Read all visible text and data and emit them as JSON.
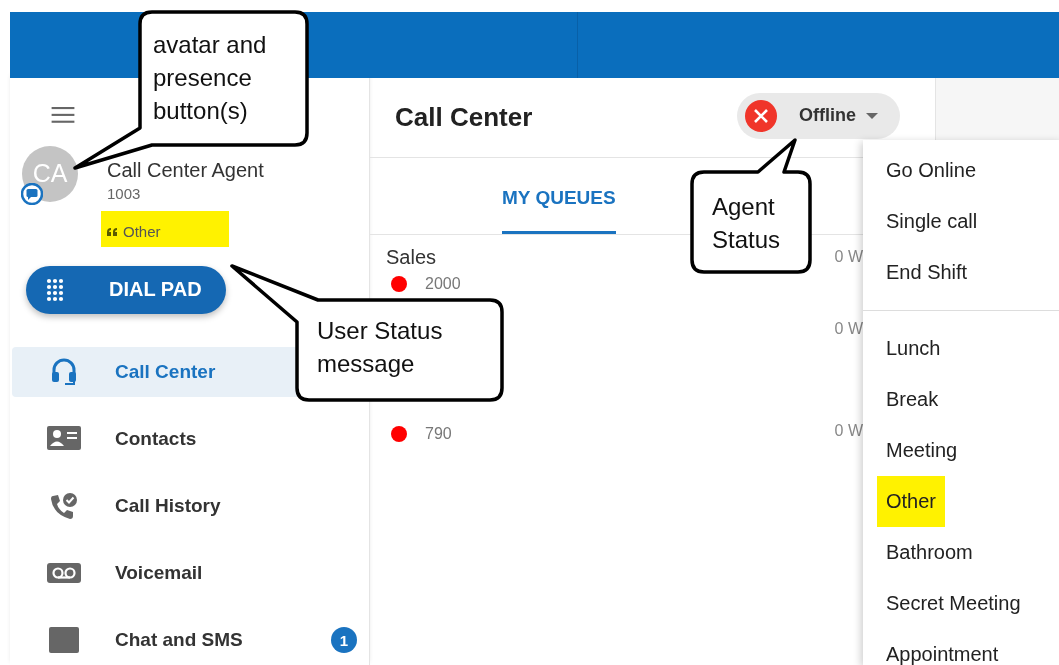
{
  "sidebar": {
    "user": {
      "initials": "CA",
      "name": "Call Center Agent",
      "extension": "1003",
      "status_message": {
        "text": "Other",
        "highlighted": true
      }
    },
    "dial_pad_button": "DIAL PAD",
    "nav_items": [
      {
        "kind": "headset",
        "label": "Call Center",
        "selected": true
      },
      {
        "kind": "contacts",
        "label": "Contacts",
        "selected": false
      },
      {
        "kind": "history",
        "label": "Call History",
        "selected": false
      },
      {
        "kind": "voicemail",
        "label": "Voicemail",
        "selected": false
      },
      {
        "kind": "chat",
        "label": "Chat and SMS",
        "selected": false,
        "badge": "1"
      }
    ]
  },
  "main": {
    "title": "Call Center",
    "agent_status": {
      "label": "Offline"
    },
    "tabs": [
      {
        "label": "MY QUEUES",
        "selected": true
      }
    ],
    "queues": [
      {
        "name": "Sales",
        "number": "2000",
        "color": "#ff0000",
        "wait": "0 W"
      },
      {
        "wait": "0 W"
      },
      {
        "number": "790",
        "color": "#ff0000",
        "wait": "0 W"
      }
    ]
  },
  "status_menu": {
    "groups": [
      {
        "items": [
          {
            "label": "Go Online",
            "highlighted": false
          },
          {
            "label": "Single call",
            "highlighted": false
          },
          {
            "label": "End Shift",
            "highlighted": false
          }
        ]
      },
      {
        "items": [
          {
            "label": "Lunch",
            "highlighted": false
          },
          {
            "label": "Break",
            "highlighted": false
          },
          {
            "label": "Meeting",
            "highlighted": false
          },
          {
            "label": "Other",
            "highlighted": true
          },
          {
            "label": "Bathroom",
            "highlighted": false
          },
          {
            "label": "Secret Meeting",
            "highlighted": false
          },
          {
            "label": "Appointment",
            "highlighted": false
          }
        ]
      }
    ]
  },
  "callouts": [
    {
      "text": "avatar and presence button(s)"
    },
    {
      "text": "Agent Status"
    },
    {
      "text": "User Status message"
    }
  ]
}
